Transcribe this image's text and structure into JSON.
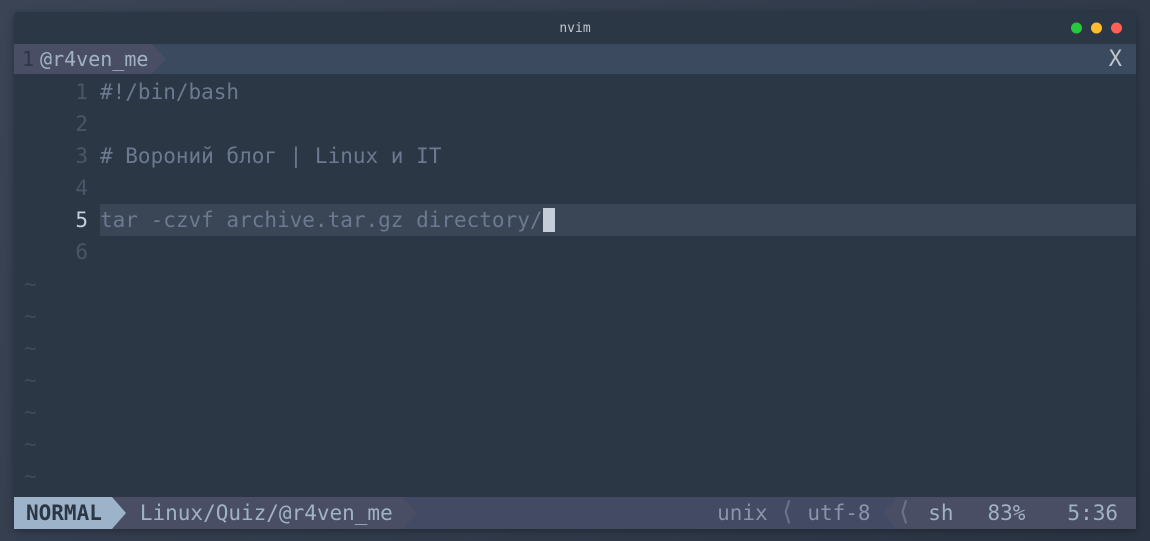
{
  "window": {
    "title": "nvim"
  },
  "tabbar": {
    "tab_number": "1",
    "tab_name": "@r4ven_me",
    "close_symbol": "X"
  },
  "editor": {
    "lines": [
      {
        "num": "1",
        "text": "#!/bin/bash",
        "current": false
      },
      {
        "num": "2",
        "text": "",
        "current": false
      },
      {
        "num": "3",
        "text": "# Вороний блог | Linux и IT",
        "current": false
      },
      {
        "num": "4",
        "text": "",
        "current": false
      },
      {
        "num": "5",
        "text": "tar -czvf archive.tar.gz directory/",
        "current": true
      },
      {
        "num": "6",
        "text": "",
        "current": false
      }
    ],
    "tilde": "~"
  },
  "statusbar": {
    "mode": "NORMAL",
    "path": "Linux/Quiz/@r4ven_me",
    "fileformat": "unix",
    "encoding": "utf-8",
    "filetype": "sh",
    "percent": "83%",
    "position": "5:36"
  }
}
